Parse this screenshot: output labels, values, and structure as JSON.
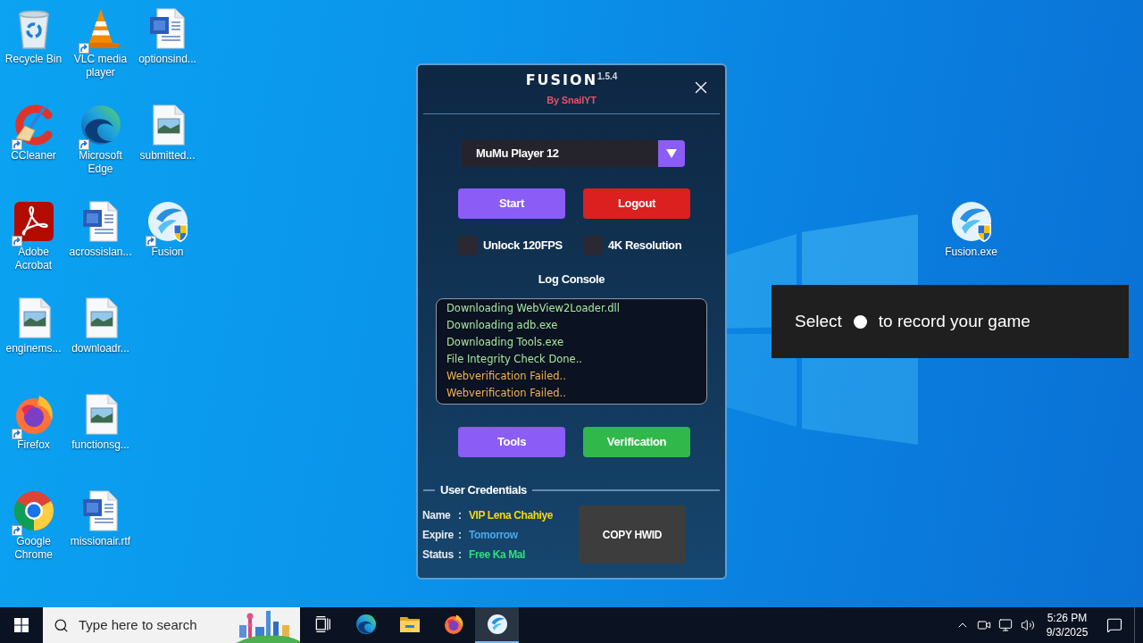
{
  "desktop_icons": [
    {
      "label": "Recycle Bin",
      "kind": "recycle-bin",
      "shortcut": false
    },
    {
      "label": "CCleaner",
      "kind": "ccleaner",
      "shortcut": true
    },
    {
      "label": "Adobe Acrobat",
      "kind": "acrobat",
      "shortcut": true
    },
    {
      "label": "enginems...",
      "kind": "image",
      "shortcut": false
    },
    {
      "label": "Firefox",
      "kind": "firefox",
      "shortcut": true
    },
    {
      "label": "Google Chrome",
      "kind": "chrome",
      "shortcut": true
    },
    {
      "label": "VLC media player",
      "kind": "vlc",
      "shortcut": true
    },
    {
      "label": "Microsoft Edge",
      "kind": "edge",
      "shortcut": true
    },
    {
      "label": "acrossislan...",
      "kind": "word",
      "shortcut": false
    },
    {
      "label": "downloadr...",
      "kind": "image",
      "shortcut": false
    },
    {
      "label": "functionsg...",
      "kind": "image",
      "shortcut": false
    },
    {
      "label": "missionair.rtf",
      "kind": "word",
      "shortcut": false
    },
    {
      "label": "optionsind...",
      "kind": "word",
      "shortcut": false
    },
    {
      "label": "submitted...",
      "kind": "image",
      "shortcut": false
    },
    {
      "label": "Fusion",
      "kind": "fusion",
      "shortcut": true
    }
  ],
  "desktop_icon_right": {
    "label": "Fusion.exe",
    "kind": "fusion",
    "shortcut": false
  },
  "app": {
    "logo": "FUSION",
    "version": "1.5.4",
    "author": "By SnailYT",
    "emulator_select": {
      "value": "MuMu Player 12"
    },
    "action_buttons": [
      {
        "label": "Start",
        "kind": "primary"
      },
      {
        "label": "Logout",
        "kind": "danger"
      }
    ],
    "options": [
      {
        "label": "Unlock 120FPS",
        "checked": false
      },
      {
        "label": "4K Resolution",
        "checked": false
      }
    ],
    "log_title": "Log Console",
    "log": [
      {
        "text": "Downloading WebView2Loader.dll",
        "color": "#a8e6a1"
      },
      {
        "text": "Downloading adb.exe",
        "color": "#a8e6a1"
      },
      {
        "text": "Downloading Tools.exe",
        "color": "#a8e6a1"
      },
      {
        "text": "File Integrity Check Done..",
        "color": "#a8e6a1"
      },
      {
        "text": "Webverification Failed..",
        "color": "#f5b150"
      },
      {
        "text": "Webverification Failed..",
        "color": "#f5b150"
      }
    ],
    "tool_buttons": [
      {
        "label": "Tools",
        "kind": "primary"
      },
      {
        "label": "Verification",
        "kind": "success"
      }
    ],
    "credentials": {
      "title": "User Credentials",
      "rows": [
        {
          "label": "Name",
          "separator": ":",
          "value": "VIP Lena Chahiye",
          "color": "#f5d90a"
        },
        {
          "label": "Expire",
          "separator": ":",
          "value": "Tomorrow",
          "color": "#4aa8ec"
        },
        {
          "label": "Status",
          "separator": ":",
          "value": "Free Ka Mal",
          "color": "#2ee07a"
        }
      ],
      "copy_button": "COPY HWID"
    }
  },
  "game_bar_tip": {
    "before": "Select",
    "after": "to record your game"
  },
  "taskbar": {
    "search": {
      "placeholder": "Type here to search"
    },
    "apps": [
      {
        "kind": "task-view",
        "selected": false
      },
      {
        "kind": "edge",
        "selected": false
      },
      {
        "kind": "file-explorer",
        "selected": false
      },
      {
        "kind": "firefox",
        "selected": false
      },
      {
        "kind": "fusion",
        "selected": true
      }
    ],
    "clock": {
      "time": "5:26 PM",
      "date": "9/3/2025"
    }
  }
}
